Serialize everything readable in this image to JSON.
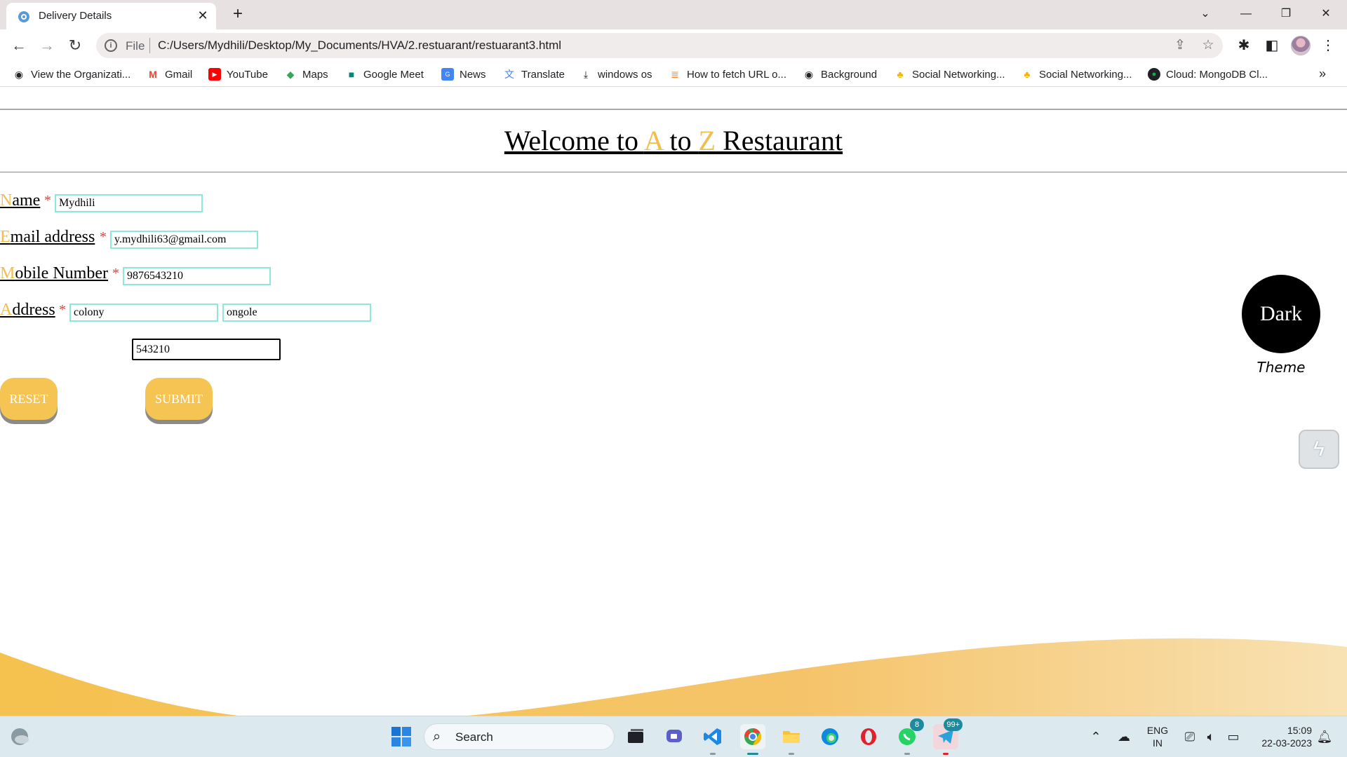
{
  "browser": {
    "tab_title": "Delivery Details",
    "tab_close": "✕",
    "new_tab": "+",
    "address_scheme": "File",
    "address_url": "C:/Users/Mydhili/Desktop/My_Documents/HVA/2.restuarant/restuarant3.html",
    "bookmarks": [
      {
        "label": "View the Organizati...",
        "icon": "globe-icon"
      },
      {
        "label": "Gmail",
        "icon": "gmail-icon"
      },
      {
        "label": "YouTube",
        "icon": "youtube-icon"
      },
      {
        "label": "Maps",
        "icon": "maps-icon"
      },
      {
        "label": "Google Meet",
        "icon": "meet-icon"
      },
      {
        "label": "News",
        "icon": "news-icon"
      },
      {
        "label": "Translate",
        "icon": "translate-icon"
      },
      {
        "label": "windows os",
        "icon": "download-icon"
      },
      {
        "label": "How to fetch URL o...",
        "icon": "stackoverflow-icon"
      },
      {
        "label": "Background",
        "icon": "globe-icon"
      },
      {
        "label": "Social Networking...",
        "icon": "site-icon"
      },
      {
        "label": "Social Networking...",
        "icon": "site-icon"
      },
      {
        "label": "Cloud: MongoDB Cl...",
        "icon": "mongodb-icon"
      }
    ],
    "bookmarks_more": "»"
  },
  "page": {
    "welcome_prefix": "Welcome to ",
    "welcome_a": "A",
    "welcome_mid": " to ",
    "welcome_z": "Z",
    "welcome_suffix": " Restaurant",
    "required_mark": "*",
    "fields": {
      "name": {
        "first": "N",
        "rest": "ame ",
        "value": "Mydhili"
      },
      "email": {
        "first": "E",
        "rest": "mail address ",
        "value": "y.mydhili63@gmail.com"
      },
      "mobile": {
        "first": "M",
        "rest": "obile Number ",
        "value": "9876543210"
      },
      "address": {
        "first": "A",
        "rest": "ddress ",
        "line1": "colony",
        "line2": "ongole",
        "pincode": "543210"
      }
    },
    "reset_label": "RESET",
    "submit_label": "SUBMIT",
    "dark_label": "Dark",
    "theme_label": "Theme",
    "accent_color": "#f2bd4f",
    "button_color": "#f5c453"
  },
  "taskbar": {
    "search_label": "Search",
    "lang_top": "ENG",
    "lang_bottom": "IN",
    "time": "15:09",
    "date": "22-03-2023",
    "whatsapp_badge": "8",
    "telegram_badge": "99+"
  }
}
